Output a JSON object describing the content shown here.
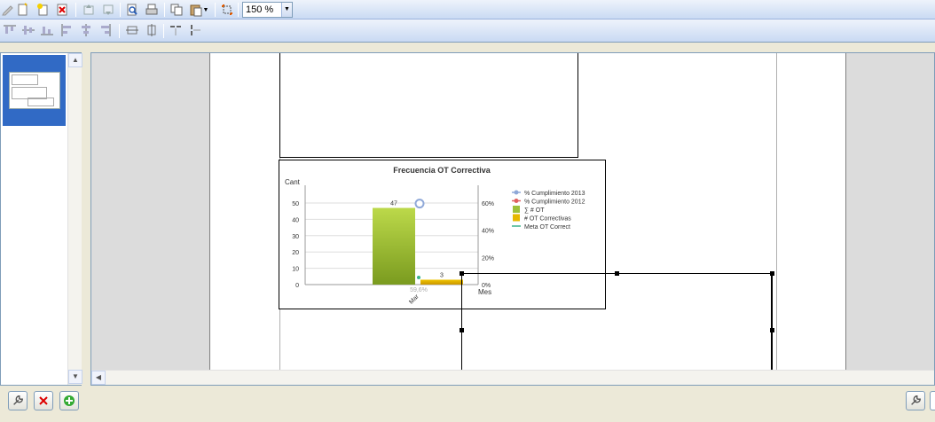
{
  "toolbar": {
    "zoom_value": "150 %",
    "icons_row1": [
      "pencil-icon",
      "new-document-icon",
      "new-item-icon",
      "delete-icon",
      "bring-front-icon",
      "send-back-icon",
      "print-preview-icon",
      "print-icon",
      "copy-icon",
      "paste-icon",
      "crop-icon"
    ],
    "icons_row2": [
      "align-top-icon",
      "align-middle-icon",
      "align-bottom-icon",
      "align-left-icon",
      "align-center-icon",
      "align-right-icon",
      "same-width-icon",
      "same-height-icon",
      "space-horizontal-icon",
      "space-vertical-icon"
    ]
  },
  "bottombar": {
    "left_icons": [
      "wrench-icon",
      "delete-icon",
      "add-icon"
    ],
    "right_icons": [
      "wrench-icon"
    ]
  },
  "chart": {
    "title": "Frecuencia OT Correctiva",
    "y_left_title": "Cant",
    "x_title": "Mes",
    "legend": [
      {
        "label": "% Cumplimiento 2013",
        "color": "#8fa8d8",
        "marker": "circle"
      },
      {
        "label": "% Cumplimiento 2012",
        "color": "#e06060",
        "marker": "circle"
      },
      {
        "label": "∑ # OT",
        "color": "#9dc03a",
        "marker": "square"
      },
      {
        "label": "# OT Correctivas",
        "color": "#e6b800",
        "marker": "square"
      },
      {
        "label": "Meta OT Correct",
        "color": "#3cb38c",
        "marker": "line"
      }
    ],
    "point_label": "59,6%"
  },
  "chart_data": {
    "type": "bar",
    "title": "Frecuencia OT Correctiva",
    "xlabel": "Mes",
    "ylabel": "Cant",
    "categories": [
      "Mar"
    ],
    "series": [
      {
        "name": "∑ # OT",
        "values": [
          47
        ],
        "color": "#9dc03a"
      },
      {
        "name": "# OT Correctivas",
        "values": [
          3
        ],
        "color": "#e6b800"
      }
    ],
    "ylim": [
      0,
      50
    ],
    "yticks": [
      "0",
      "10",
      "20",
      "30",
      "40",
      "50"
    ],
    "y2ticks": [
      "0%",
      "20%",
      "40%",
      "60%"
    ],
    "y2lim": [
      0,
      60
    ],
    "line_points": [
      {
        "series": "% Cumplimiento 2013",
        "value_pct": 59.6,
        "label": "59,6%"
      }
    ],
    "grid": true,
    "legend_position": "right"
  }
}
